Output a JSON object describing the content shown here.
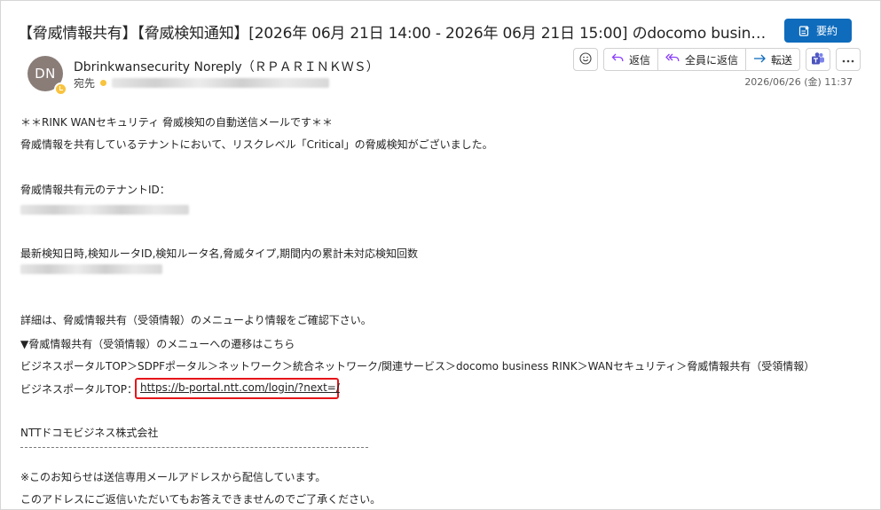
{
  "email": {
    "subject": "【脅威情報共有】【脅威検知通知】[2026年 06月 21日 14:00 - 2026年 06月 21日 15:00] のdocomo business RINK WAN",
    "summary_label": "要約",
    "avatar_initials": "DN",
    "sender": "Dbrinkwansecurity Noreply（ＲＰＡＲＩＮＫＷＳ）",
    "to_label": "宛先",
    "date": "2026/06/26 (金) 11:37"
  },
  "actions": {
    "reply": "返信",
    "reply_all": "全員に返信",
    "forward": "転送"
  },
  "body": {
    "line1": "＊＊RINK WANセキュリティ 脅威検知の自動送信メールです＊＊",
    "line2": "脅威情報を共有しているテナントにおいて、リスクレベル「Critical」の脅威検知がございました。",
    "tenant_label": "脅威情報共有元のテナントID：",
    "detect_label": "最新検知日時,検知ルータID,検知ルータ名,脅威タイプ,期間内の累計未対応検知回数",
    "detail": "詳細は、脅威情報共有（受領情報）のメニューより情報をご確認下さい。",
    "menu_path_title": "▼脅威情報共有（受領情報）のメニューへの遷移はこちら",
    "menu_path": "ビジネスポータルTOP＞SDPFポータル＞ネットワーク＞統合ネットワーク/関連サービス＞docomo business RINK＞WANセキュリティ＞脅威情報共有（受領情報）",
    "portal_label": "ビジネスポータルTOP：",
    "portal_url": "https://b-portal.ntt.com/login/?next=/",
    "company": "NTTドコモビジネス株式会社",
    "separator": "--------------------------------------------------------------------------------------------",
    "notice1": "※このお知らせは送信専用メールアドレスから配信しています。",
    "notice2": "このアドレスにご返信いただいてもお答えできませんのでご了承ください。"
  },
  "colors": {
    "accent": "#0f6cbd",
    "highlight": "#e5151a",
    "avatar": "#8a7d78",
    "presence": "#f8c33e"
  }
}
